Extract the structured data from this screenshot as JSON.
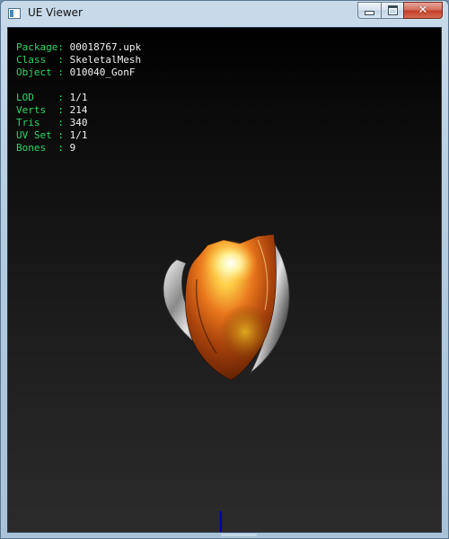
{
  "window": {
    "title": "UE Viewer",
    "close_symbol": "✕"
  },
  "icons": {
    "app": "app-window-icon",
    "minimize": "minimize-icon",
    "maximize": "maximize-icon",
    "close": "close-icon"
  },
  "info": {
    "package": {
      "key": "Package: ",
      "value": "00018767.upk"
    },
    "class": {
      "key": "Class  : ",
      "value": "SkeletalMesh"
    },
    "object": {
      "key": "Object : ",
      "value": "010040_GonF"
    },
    "lod": {
      "key": "LOD    : ",
      "value": "1/1"
    },
    "verts": {
      "key": "Verts  : ",
      "value": "214"
    },
    "tris": {
      "key": "Tris   : ",
      "value": "340"
    },
    "uvset": {
      "key": "UV Set : ",
      "value": "1/1"
    },
    "bones": {
      "key": "Bones  : ",
      "value": "9"
    }
  },
  "colors": {
    "label_green": "#27d86b",
    "value_white": "#f2f2f2",
    "viewport_bg_top": "#000000",
    "viewport_bg_bottom": "#2b2b2b",
    "axis_blue": "#0000b8",
    "mesh_orange": "#e8761c",
    "mesh_highlight": "#fff8c8"
  }
}
